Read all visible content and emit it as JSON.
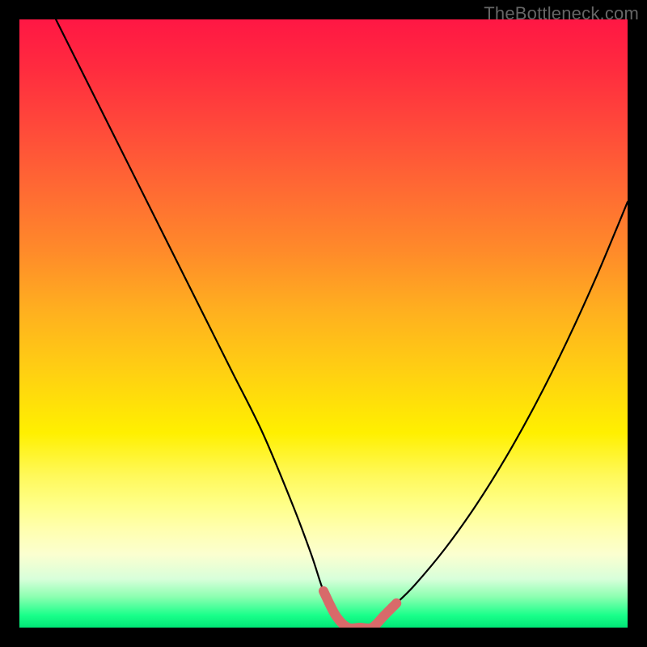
{
  "watermark": "TheBottleneck.com",
  "chart_data": {
    "type": "line",
    "title": "",
    "xlabel": "",
    "ylabel": "",
    "xlim": [
      0,
      100
    ],
    "ylim": [
      0,
      100
    ],
    "series": [
      {
        "name": "main-curve",
        "color": "#000000",
        "x": [
          6,
          10,
          15,
          20,
          25,
          30,
          35,
          40,
          45,
          48,
          50,
          52,
          54,
          56,
          58,
          60,
          62,
          65,
          70,
          75,
          80,
          85,
          90,
          95,
          100
        ],
        "values": [
          100,
          92,
          82,
          72,
          62,
          52,
          42,
          32,
          20,
          12,
          6,
          2,
          0,
          0,
          0,
          2,
          4,
          7,
          13,
          20,
          28,
          37,
          47,
          58,
          70
        ]
      },
      {
        "name": "flat-highlight",
        "color": "#d86a6a",
        "x": [
          50,
          52,
          54,
          56,
          58,
          60,
          62
        ],
        "values": [
          6,
          2,
          0,
          0,
          0,
          2,
          4
        ]
      }
    ]
  }
}
